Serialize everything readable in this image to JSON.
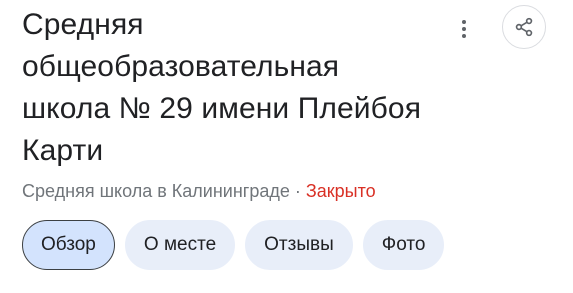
{
  "place": {
    "title": "Средняя\nобщеобразовательная\nшкола № 29 имени Плейбоя\nКарти",
    "category": "Средняя школа в Калининграде",
    "separator": " · ",
    "status": "Закрыто"
  },
  "tabs": [
    {
      "label": "Обзор",
      "active": true
    },
    {
      "label": "О месте",
      "active": false
    },
    {
      "label": "Отзывы",
      "active": false
    },
    {
      "label": "Фото",
      "active": false
    }
  ],
  "icons": {
    "more": "more-vertical-icon",
    "share": "share-icon"
  },
  "colors": {
    "status_closed": "#d93025",
    "chip_bg": "#e8eef9",
    "chip_active_bg": "#d3e3fd",
    "secondary_text": "#70757a"
  }
}
